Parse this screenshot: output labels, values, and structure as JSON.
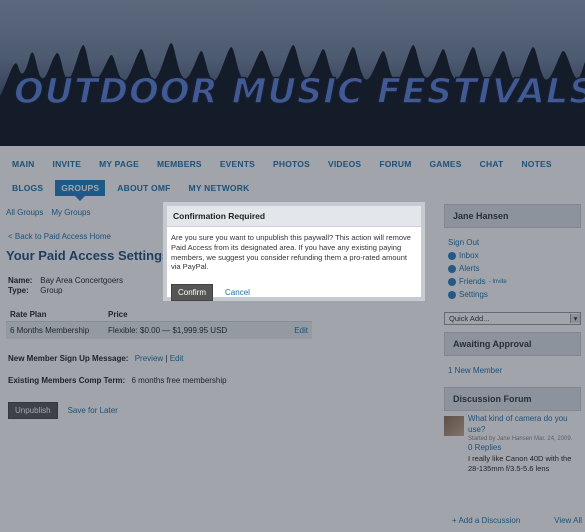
{
  "banner": {
    "title": "OUTDOOR MUSIC FESTIVALS"
  },
  "nav": {
    "row1": [
      "MAIN",
      "INVITE",
      "MY PAGE",
      "MEMBERS",
      "EVENTS",
      "PHOTOS",
      "VIDEOS",
      "FORUM",
      "GAMES",
      "CHAT",
      "NOTES"
    ],
    "row2": [
      "BLOGS",
      "GROUPS",
      "ABOUT OMF",
      "MY NETWORK"
    ],
    "active": "GROUPS"
  },
  "main": {
    "subnav": [
      "All Groups",
      "My Groups"
    ],
    "back_link": "< Back to Paid Access Home",
    "title": "Your Paid Access Settings",
    "name_label": "Name:",
    "name_value": "Bay Area Concertgoers",
    "type_label": "Type:",
    "type_value": "Group",
    "table": {
      "headers": [
        "Rate Plan",
        "Price"
      ],
      "rows": [
        {
          "plan": "6 Months Membership",
          "price": "Flexible: $0.00 — $1,999.95 USD",
          "edit": "Edit"
        }
      ]
    },
    "signup_label": "New Member Sign Up Message:",
    "signup_preview": "Preview",
    "signup_edit": "Edit",
    "comp_label": "Existing Members Comp Term:",
    "comp_value": "6 months free membership",
    "unpublish_label": "Unpublish",
    "save_later_label": "Save for Later"
  },
  "sidebar": {
    "profile_name": "Jane Hansen",
    "sign_out": "Sign Out",
    "inbox": "Inbox",
    "alerts": "Alerts",
    "friends": "Friends",
    "friends_invite": "- Invite",
    "settings": "Settings",
    "quick_add": "Quick Add...",
    "approval_title": "Awaiting Approval",
    "new_member": "1 New Member",
    "forum_title": "Discussion Forum",
    "thread_title": "What kind of camera do you use?",
    "thread_meta": "Started by Jane Hansen Mar. 24, 2009.",
    "thread_replies": "0 Replies",
    "thread_reply_text": "I really like Canon 40D with the 28-135mm f/3.5-5.6 lens",
    "add_discussion": "+ Add a Discussion",
    "view_all": "View All"
  },
  "modal": {
    "title": "Confirmation Required",
    "text": "Are you sure you want to unpublish this paywall? This action will remove Paid Access from its designated area. If you have any existing paying members, we suggest you consider refunding them a pro-rated amount via PayPal.",
    "confirm_label": "Confirm",
    "cancel_label": "Cancel"
  },
  "colors": {
    "link": "#1d6ea8",
    "nav_active": "#1d7fc2",
    "title": "#1d4f80"
  }
}
